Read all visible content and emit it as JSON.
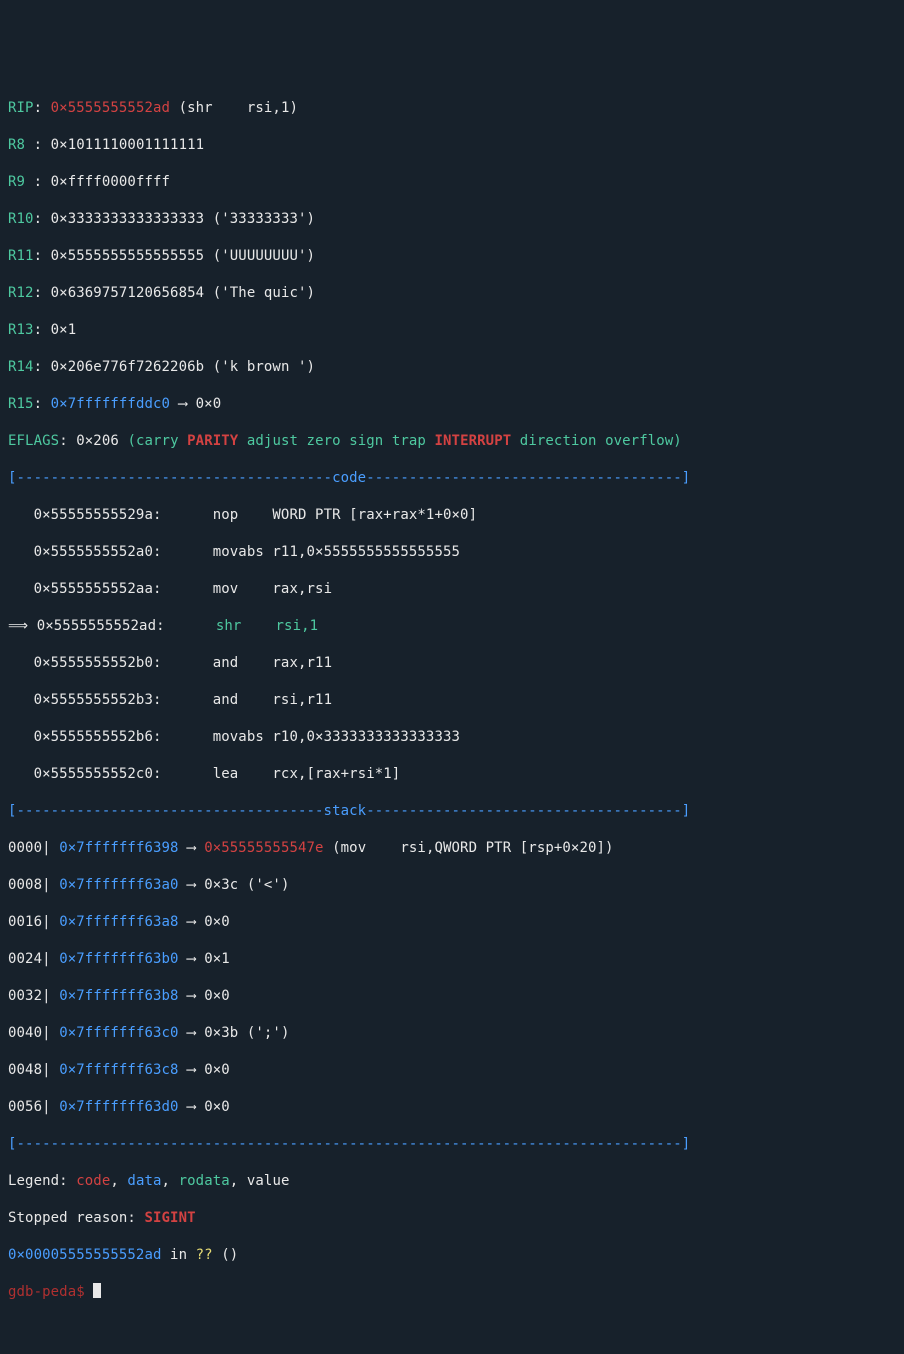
{
  "registers": {
    "rip": {
      "name": "RIP",
      "value": "0×5555555552ad",
      "asm": "(shr    rsi,1)"
    },
    "r8": {
      "name": "R8 ",
      "value": "0×1011110001111111"
    },
    "r9": {
      "name": "R9 ",
      "value": "0×ffff0000ffff"
    },
    "r10": {
      "name": "R10",
      "value": "0×3333333333333333",
      "note": "('33333333')"
    },
    "r11": {
      "name": "R11",
      "value": "0×5555555555555555",
      "note": "('UUUUUUUU')"
    },
    "r12": {
      "name": "R12",
      "value": "0×6369757120656854",
      "note": "('The quic')"
    },
    "r13": {
      "name": "R13",
      "value": "0×1"
    },
    "r14": {
      "name": "R14",
      "value": "0×206e776f7262206b",
      "note": "('k brown ')"
    },
    "r15": {
      "name": "R15",
      "value": "0×7fffffffddc0",
      "arrow": "⟶ ",
      "deref": "0×0"
    }
  },
  "eflags": {
    "label": "EFLAGS",
    "value": "0×206",
    "flags_pre": "(carry ",
    "parity": "PARITY",
    "flags_mid": " adjust zero sign trap ",
    "interrupt": "INTERRUPT",
    "flags_post": " direction overflow)"
  },
  "code_header": "[-------------------------------------code-------------------------------------]",
  "code": [
    {
      "addr": "   0×55555555529a:      ",
      "op": "nop    ",
      "args": "WORD PTR [rax+rax*1+0×0]"
    },
    {
      "addr": "   0×5555555552a0:      ",
      "op": "movabs ",
      "args": "r11,0×5555555555555555"
    },
    {
      "addr": "   0×5555555552aa:      ",
      "op": "mov    ",
      "args": "rax,rsi"
    },
    {
      "arrow": "⟹ ",
      "addr": "0×5555555552ad:      ",
      "op": "shr    ",
      "args": "rsi,1",
      "current": true
    },
    {
      "addr": "   0×5555555552b0:      ",
      "op": "and    ",
      "args": "rax,r11"
    },
    {
      "addr": "   0×5555555552b3:      ",
      "op": "and    ",
      "args": "rsi,r11"
    },
    {
      "addr": "   0×5555555552b6:      ",
      "op": "movabs ",
      "args": "r10,0×3333333333333333"
    },
    {
      "addr": "   0×5555555552c0:      ",
      "op": "lea    ",
      "args": "rcx,[rax+rsi*1]"
    }
  ],
  "stack_header": "[------------------------------------stack-------------------------------------]",
  "stack": [
    {
      "offset": "0000",
      "addr": "0×7fffffff6398",
      "arrow": "⟶ ",
      "target": "0×55555555547e",
      "asm": "(mov    rsi,QWORD PTR [rsp+0×20])",
      "red_target": true
    },
    {
      "offset": "0008",
      "addr": "0×7fffffff63a0",
      "arrow": "⟶ ",
      "target": "0×3c ('<')"
    },
    {
      "offset": "0016",
      "addr": "0×7fffffff63a8",
      "arrow": "⟶ ",
      "target": "0×0"
    },
    {
      "offset": "0024",
      "addr": "0×7fffffff63b0",
      "arrow": "⟶ ",
      "target": "0×1"
    },
    {
      "offset": "0032",
      "addr": "0×7fffffff63b8",
      "arrow": "⟶ ",
      "target": "0×0"
    },
    {
      "offset": "0040",
      "addr": "0×7fffffff63c0",
      "arrow": "⟶ ",
      "target": "0×3b (';')"
    },
    {
      "offset": "0048",
      "addr": "0×7fffffff63c8",
      "arrow": "⟶ ",
      "target": "0×0"
    },
    {
      "offset": "0056",
      "addr": "0×7fffffff63d0",
      "arrow": "⟶ ",
      "target": "0×0"
    }
  ],
  "divider": "[------------------------------------------------------------------------------]",
  "legend": {
    "prefix": "Legend: ",
    "code": "code",
    "sep1": ", ",
    "data": "data",
    "sep2": ", ",
    "rodata": "rodata",
    "sep3": ", ",
    "value": "value"
  },
  "stopped": {
    "label": "Stopped reason: ",
    "reason": "SIGINT"
  },
  "location": {
    "addr": "0×00005555555552ad",
    "in": " in ",
    "qq": "??",
    "paren": " ()"
  },
  "prompt": "gdb-peda$ "
}
